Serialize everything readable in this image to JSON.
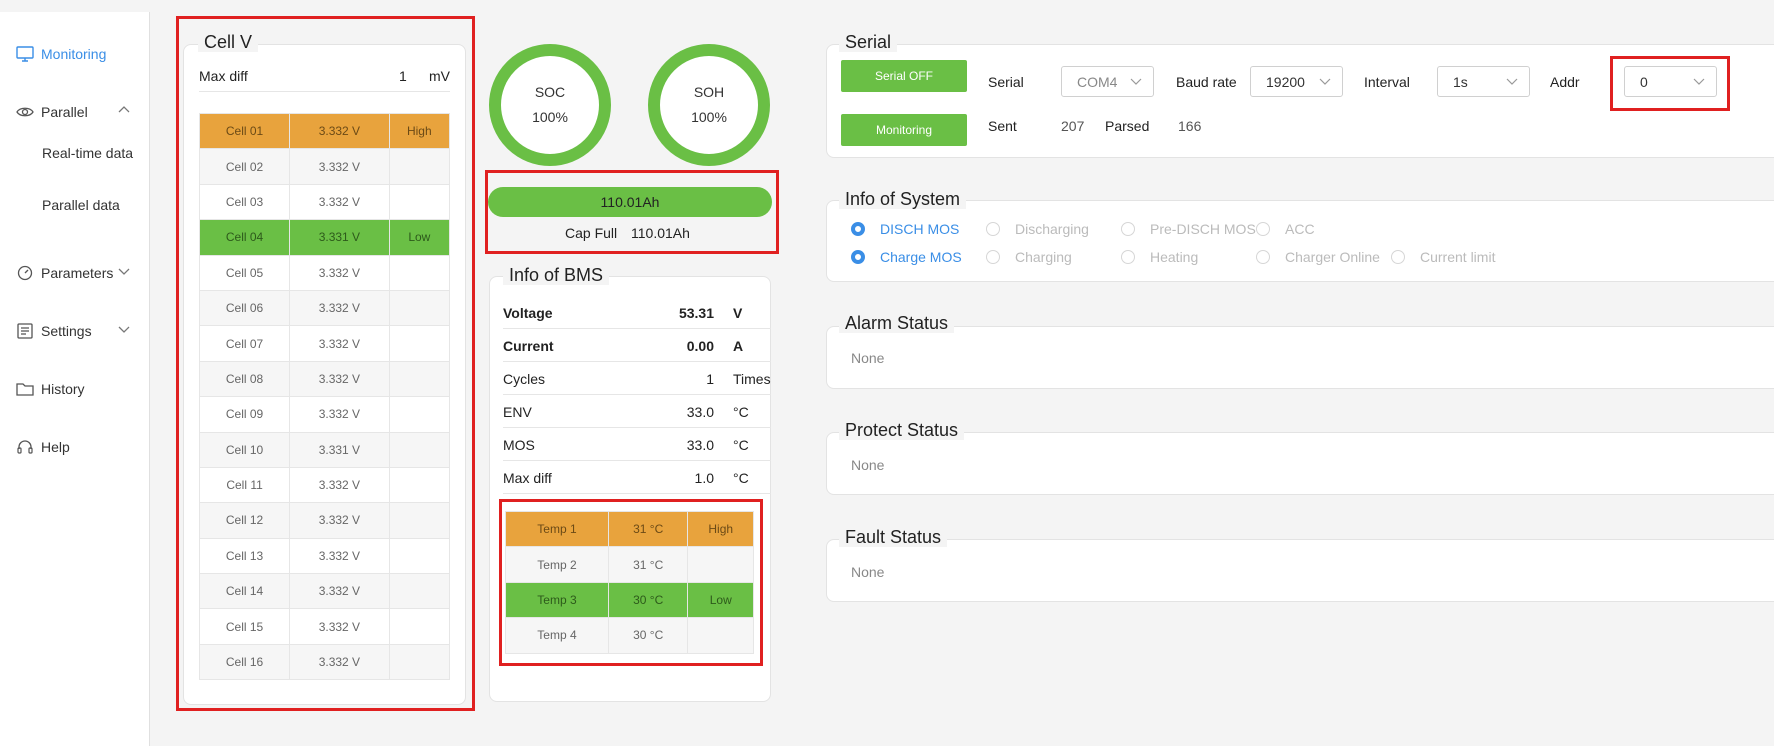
{
  "sidebar": {
    "items": [
      {
        "label": "Monitoring",
        "icon": "monitor-icon"
      },
      {
        "label": "Parallel",
        "icon": "eye-icon"
      },
      {
        "label": "Real-time data"
      },
      {
        "label": "Parallel data"
      },
      {
        "label": "Parameters",
        "icon": "gauge-icon"
      },
      {
        "label": "Settings",
        "icon": "settings-icon"
      },
      {
        "label": "History",
        "icon": "folder-icon"
      },
      {
        "label": "Help",
        "icon": "headset-icon"
      }
    ]
  },
  "cellv": {
    "title": "Cell V",
    "maxdiff_label": "Max diff",
    "maxdiff_value": "1",
    "maxdiff_unit": "mV",
    "cells": [
      {
        "name": "Cell 01",
        "value": "3.332 V",
        "status": "High"
      },
      {
        "name": "Cell 02",
        "value": "3.332 V",
        "status": ""
      },
      {
        "name": "Cell 03",
        "value": "3.332 V",
        "status": ""
      },
      {
        "name": "Cell 04",
        "value": "3.331 V",
        "status": "Low"
      },
      {
        "name": "Cell 05",
        "value": "3.332 V",
        "status": ""
      },
      {
        "name": "Cell 06",
        "value": "3.332 V",
        "status": ""
      },
      {
        "name": "Cell 07",
        "value": "3.332 V",
        "status": ""
      },
      {
        "name": "Cell 08",
        "value": "3.332 V",
        "status": ""
      },
      {
        "name": "Cell 09",
        "value": "3.332 V",
        "status": ""
      },
      {
        "name": "Cell 10",
        "value": "3.331 V",
        "status": ""
      },
      {
        "name": "Cell 11",
        "value": "3.332 V",
        "status": ""
      },
      {
        "name": "Cell 12",
        "value": "3.332 V",
        "status": ""
      },
      {
        "name": "Cell 13",
        "value": "3.332 V",
        "status": ""
      },
      {
        "name": "Cell 14",
        "value": "3.332 V",
        "status": ""
      },
      {
        "name": "Cell 15",
        "value": "3.332 V",
        "status": ""
      },
      {
        "name": "Cell 16",
        "value": "3.332 V",
        "status": ""
      }
    ]
  },
  "gauges": {
    "soc_label": "SOC",
    "soc_value": "100%",
    "soh_label": "SOH",
    "soh_value": "100%"
  },
  "capacity": {
    "bar_text": "110.01Ah",
    "full_label": "Cap Full",
    "full_value": "110.01Ah"
  },
  "bms": {
    "title": "Info of BMS",
    "rows": [
      {
        "label": "Voltage",
        "value": "53.31",
        "unit": "V"
      },
      {
        "label": "Current",
        "value": "0.00",
        "unit": "A"
      },
      {
        "label": "Cycles",
        "value": "1",
        "unit": "Times"
      },
      {
        "label": "ENV",
        "value": "33.0",
        "unit": "°C"
      },
      {
        "label": "MOS",
        "value": "33.0",
        "unit": "°C"
      },
      {
        "label": "Max diff",
        "value": "1.0",
        "unit": "°C"
      }
    ],
    "temps": [
      {
        "name": "Temp 1",
        "value": "31 °C",
        "status": "High"
      },
      {
        "name": "Temp 2",
        "value": "31 °C",
        "status": ""
      },
      {
        "name": "Temp 3",
        "value": "30 °C",
        "status": "Low"
      },
      {
        "name": "Temp 4",
        "value": "30 °C",
        "status": ""
      }
    ]
  },
  "serial": {
    "title": "Serial",
    "off_button": "Serial OFF",
    "monitoring_button": "Monitoring",
    "serial_label": "Serial",
    "serial_value": "COM4",
    "baud_label": "Baud rate",
    "baud_value": "19200",
    "interval_label": "Interval",
    "interval_value": "1s",
    "addr_label": "Addr",
    "addr_value": "0",
    "sent_label": "Sent",
    "sent_value": "207",
    "parsed_label": "Parsed",
    "parsed_value": "166"
  },
  "system": {
    "title": "Info of System",
    "flags": [
      {
        "label": "DISCH MOS",
        "on": true
      },
      {
        "label": "Discharging",
        "on": false
      },
      {
        "label": "Pre-DISCH MOS",
        "on": false
      },
      {
        "label": "ACC",
        "on": false
      },
      {
        "label": "Charge MOS",
        "on": true
      },
      {
        "label": "Charging",
        "on": false
      },
      {
        "label": "Heating",
        "on": false
      },
      {
        "label": "Charger Online",
        "on": false
      },
      {
        "label": "Current limit",
        "on": false
      }
    ]
  },
  "alarm": {
    "title": "Alarm Status",
    "value": "None"
  },
  "protect": {
    "title": "Protect Status",
    "value": "None"
  },
  "fault": {
    "title": "Fault Status",
    "value": "None"
  },
  "colors": {
    "green": "#6abf45",
    "orange": "#e8a33d",
    "blue": "#3a8ee6",
    "highlight": "#e02020"
  }
}
